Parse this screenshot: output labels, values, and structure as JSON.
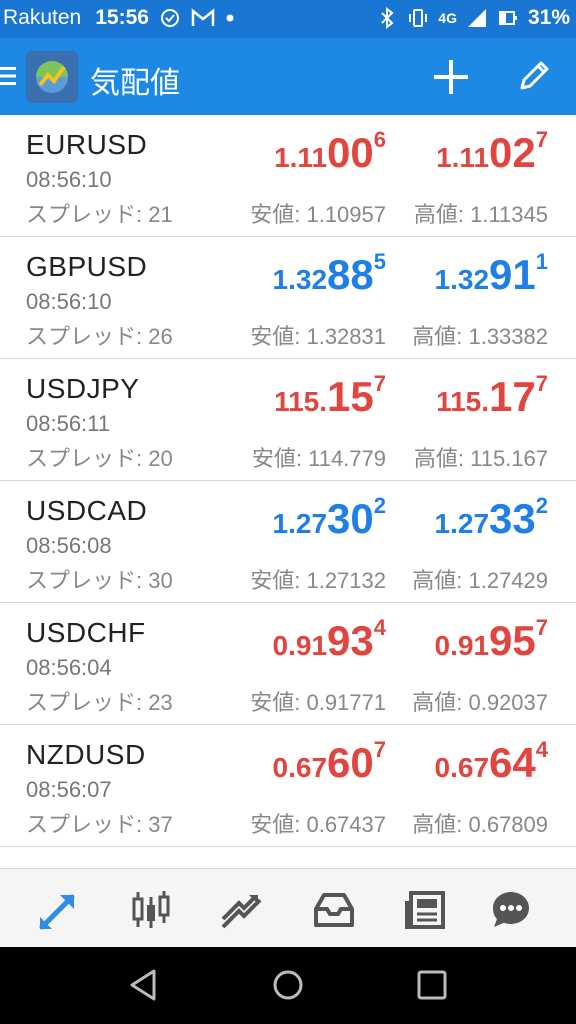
{
  "status_bar": {
    "carrier": "Rakuten",
    "time": "15:56",
    "network": "4G",
    "battery": "31%"
  },
  "app_bar": {
    "title": "気配値"
  },
  "quotes": [
    {
      "symbol": "EURUSD",
      "time": "08:56:10",
      "spread": "スプレッド: 21",
      "bid": {
        "pre": "1.11",
        "big": "00",
        "sup": "6"
      },
      "ask": {
        "pre": "1.11",
        "big": "02",
        "sup": "7"
      },
      "low": "安値: 1.10957",
      "high": "高値: 1.11345",
      "color": "red"
    },
    {
      "symbol": "GBPUSD",
      "time": "08:56:10",
      "spread": "スプレッド: 26",
      "bid": {
        "pre": "1.32",
        "big": "88",
        "sup": "5"
      },
      "ask": {
        "pre": "1.32",
        "big": "91",
        "sup": "1"
      },
      "low": "安値: 1.32831",
      "high": "高値: 1.33382",
      "color": "blue"
    },
    {
      "symbol": "USDJPY",
      "time": "08:56:11",
      "spread": "スプレッド: 20",
      "bid": {
        "pre": "115.",
        "big": "15",
        "sup": "7"
      },
      "ask": {
        "pre": "115.",
        "big": "17",
        "sup": "7"
      },
      "low": "安値: 114.779",
      "high": "高値: 115.167",
      "color": "red"
    },
    {
      "symbol": "USDCAD",
      "time": "08:56:08",
      "spread": "スプレッド: 30",
      "bid": {
        "pre": "1.27",
        "big": "30",
        "sup": "2"
      },
      "ask": {
        "pre": "1.27",
        "big": "33",
        "sup": "2"
      },
      "low": "安値: 1.27132",
      "high": "高値: 1.27429",
      "color": "blue"
    },
    {
      "symbol": "USDCHF",
      "time": "08:56:04",
      "spread": "スプレッド: 23",
      "bid": {
        "pre": "0.91",
        "big": "93",
        "sup": "4"
      },
      "ask": {
        "pre": "0.91",
        "big": "95",
        "sup": "7"
      },
      "low": "安値: 0.91771",
      "high": "高値: 0.92037",
      "color": "red"
    },
    {
      "symbol": "NZDUSD",
      "time": "08:56:07",
      "spread": "スプレッド: 37",
      "bid": {
        "pre": "0.67",
        "big": "60",
        "sup": "7"
      },
      "ask": {
        "pre": "0.67",
        "big": "64",
        "sup": "4"
      },
      "low": "安値: 0.67437",
      "high": "高値: 0.67809",
      "color": "red"
    }
  ],
  "bottom_nav": [
    "quotes-icon",
    "chart-icon",
    "trade-icon",
    "history-icon",
    "news-icon",
    "chat-icon"
  ],
  "colors": {
    "primary": "#1e88e5",
    "up": "#1e7fe6",
    "down": "#e0453f",
    "active_nav": "#2f8de4"
  }
}
